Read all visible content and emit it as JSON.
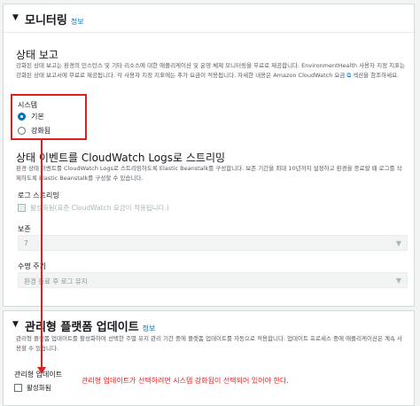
{
  "monitoring": {
    "title": "모니터링",
    "info": "정보",
    "status_report": {
      "heading": "상태 보고",
      "description": "강화된 상태 보고는 환경의 인스턴스 및 기타 리소스에 대한 애플리케이션 및 운영 체제 모니터링을 무료로 제공합니다. EnvironmentHealth 사용자 지정 지표는 강화된 상태 보고서에 무료로 제공됩니다. 각 사용자 지정 지표에는 추가 요금이 적용됩니다. 자세한 내용은 Amazon CloudWatch 요금",
      "link_suffix": "섹션을 참조하세요.",
      "system_label": "시스템",
      "options": [
        "기본",
        "강화됨"
      ],
      "selected": "기본"
    },
    "streaming": {
      "heading": "상태 이벤트를 CloudWatch Logs로 스트리밍",
      "description": "환경 상태 이벤트를 CloudWatch Logs로 스트리밍하도록 Elastic Beanstalk를 구성합니다. 보존 기간을 최대 10년까지 설정하고 환경을 종료할 때 로그를 삭제하도록 Elastic Beanstalk를 구성할 수 있습니다.",
      "log_streaming_label": "로그 스트리밍",
      "log_streaming_checkbox": "활성화됨(표준 CloudWatch 요금이 적용됩니다.)",
      "retention_label": "보존",
      "retention_value": "7",
      "lifecycle_label": "수명 주기",
      "lifecycle_value": "환경 종료 후 로그 유지"
    }
  },
  "updates": {
    "title": "관리형 플랫폼 업데이트",
    "info": "정보",
    "description": "관리형 플랫폼 업데이트를 활성화하여 선택한 주별 유지 관리 기간 중에 플랫폼 업데이트를 자동으로 적용합니다. 업데이트 프로세스 중에 애플리케이션은 계속 사용할 수 있습니다.",
    "field_label": "관리형 업데이트",
    "checkbox_label": "활성화됨"
  },
  "annotation": "관리형 업데이트가 선택하려면 시스템 강화됨이 선택되어 있어야 한다."
}
